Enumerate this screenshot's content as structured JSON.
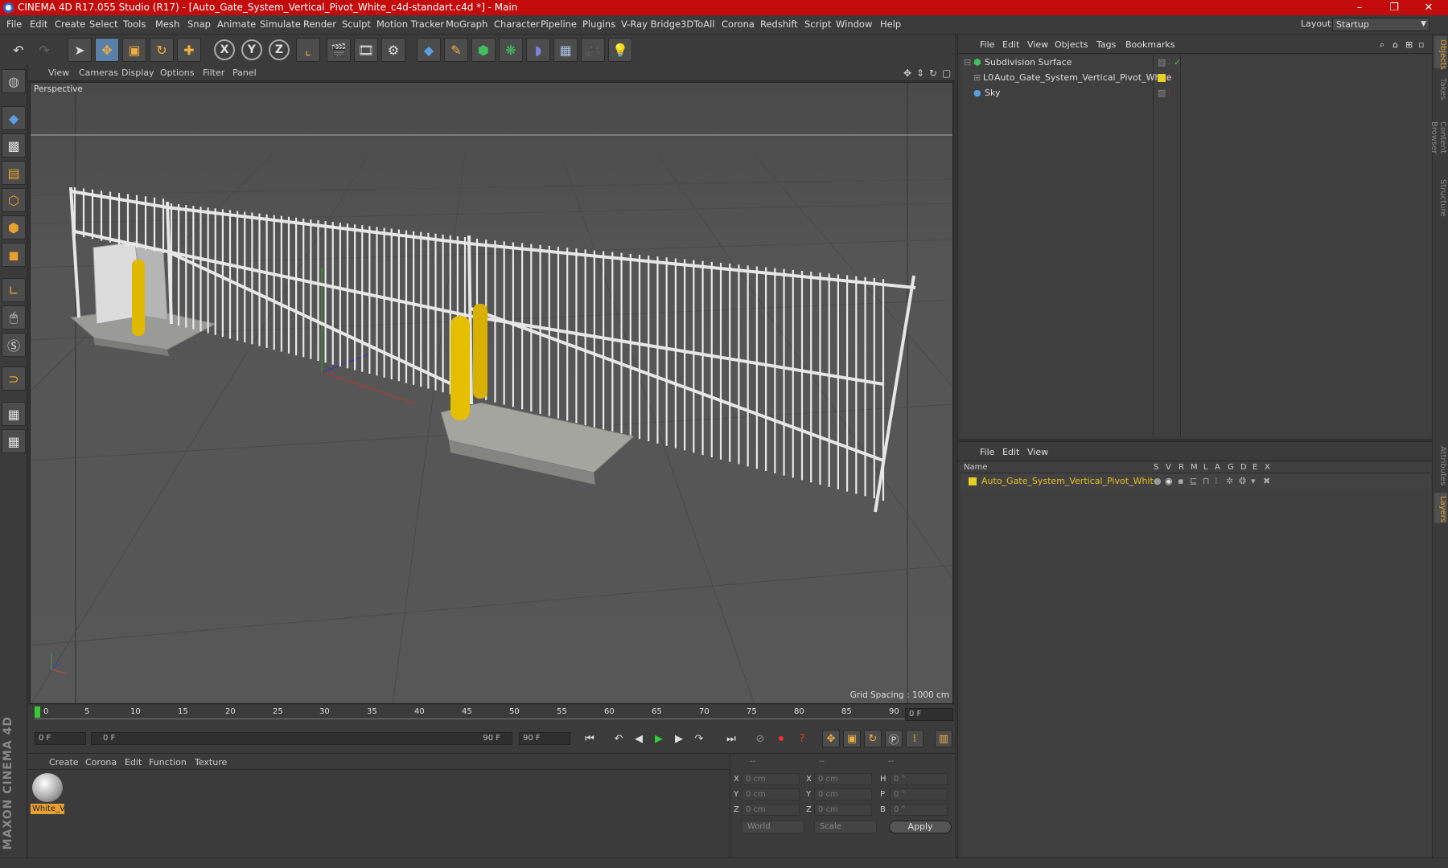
{
  "window": {
    "title": "CINEMA 4D R17.055 Studio (R17) - [Auto_Gate_System_Vertical_Pivot_White_c4d-standart.c4d *] - Main",
    "minimize": "–",
    "maximize": "❐",
    "close": "✕"
  },
  "menubar": {
    "items": [
      "File",
      "Edit",
      "Create",
      "Select",
      "Tools",
      "Mesh",
      "Snap",
      "Animate",
      "Simulate",
      "Render",
      "Sculpt",
      "Motion Tracker",
      "MoGraph",
      "Character",
      "Pipeline",
      "Plugins",
      "V-Ray Bridge",
      "3DToAll",
      "Corona",
      "Redshift",
      "Script",
      "Window",
      "Help"
    ],
    "layout_label": "Layout:",
    "layout_value": "Startup"
  },
  "toolbar": {
    "axis_x": "X",
    "axis_y": "Y",
    "axis_z": "Z"
  },
  "viewport": {
    "menu": [
      "View",
      "Cameras",
      "Display",
      "Options",
      "Filter",
      "Panel"
    ],
    "camera_label": "Perspective",
    "grid_spacing": "Grid Spacing : 1000 cm"
  },
  "timeline": {
    "ticks": [
      "0",
      "5",
      "10",
      "15",
      "20",
      "25",
      "30",
      "35",
      "40",
      "45",
      "50",
      "55",
      "60",
      "65",
      "70",
      "75",
      "80",
      "85",
      "90"
    ],
    "current_frame": "0 F"
  },
  "playback": {
    "start_field": "0 F",
    "range_start": "0 F",
    "range_end": "90 F",
    "end_field": "90 F"
  },
  "material_panel": {
    "menu": [
      "Create",
      "Corona",
      "Edit",
      "Function",
      "Texture"
    ],
    "material_name": "White_V"
  },
  "coordinates": {
    "headers": [
      "--",
      "--",
      "--"
    ],
    "pos_labels": [
      "X",
      "Y",
      "Z"
    ],
    "pos_values": [
      "0 cm",
      "0 cm",
      "0 cm"
    ],
    "size_labels": [
      "X",
      "Y",
      "Z"
    ],
    "size_values": [
      "0 cm",
      "0 cm",
      "0 cm"
    ],
    "rot_labels": [
      "H",
      "P",
      "B"
    ],
    "rot_values": [
      "0 °",
      "0 °",
      "0 °"
    ],
    "mode_world": "World",
    "mode_scale": "Scale",
    "apply": "Apply"
  },
  "object_manager": {
    "menu": [
      "File",
      "Edit",
      "View",
      "Objects",
      "Tags",
      "Bookmarks"
    ],
    "objects": [
      {
        "name": "Subdivision Surface"
      },
      {
        "name": "Auto_Gate_System_Vertical_Pivot_White"
      },
      {
        "name": "Sky"
      }
    ]
  },
  "layer_manager": {
    "menu": [
      "File",
      "Edit",
      "View"
    ],
    "columns": [
      "Name",
      "S",
      "V",
      "R",
      "M",
      "L",
      "A",
      "G",
      "D",
      "E",
      "X"
    ],
    "layers": [
      {
        "name": "Auto_Gate_System_Vertical_Pivot_White"
      }
    ]
  },
  "right_tabs": [
    "Objects",
    "Takes",
    "Content Browser",
    "Structure",
    "Attributes",
    "Layers"
  ],
  "brand": "MAXON CINEMA 4D",
  "colors": {
    "title_red": "#c30b0b",
    "accent_orange": "#e8a030",
    "layer_yellow": "#e8d020"
  }
}
